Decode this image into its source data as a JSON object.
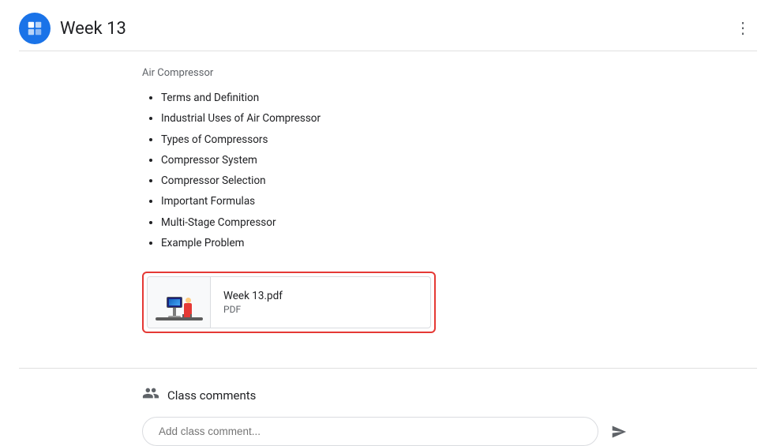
{
  "header": {
    "title": "Week 13",
    "app_icon_label": "📋",
    "more_options_label": "⋮"
  },
  "content": {
    "section_label": "Air Compressor",
    "bullet_items": [
      "Terms and Definition",
      "Industrial Uses of Air Compressor",
      "Types of Compressors",
      "Compressor System",
      "Compressor Selection",
      "Important Formulas",
      "Multi-Stage Compressor",
      "Example Problem"
    ]
  },
  "pdf_card": {
    "filename": "Week 13.pdf",
    "type": "PDF"
  },
  "comments": {
    "section_label": "Class comments",
    "input_placeholder": "Add class comment..."
  }
}
